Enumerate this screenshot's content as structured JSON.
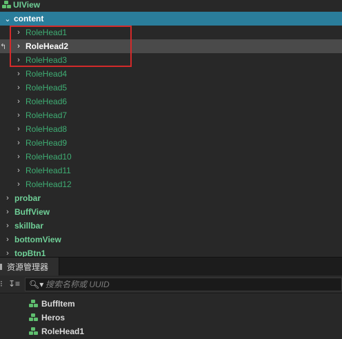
{
  "hierarchy": {
    "root": {
      "label": "UIView"
    },
    "content": {
      "label": "content"
    },
    "children": [
      {
        "label": "RoleHead1"
      },
      {
        "label": "RoleHead2"
      },
      {
        "label": "RoleHead3"
      },
      {
        "label": "RoleHead4"
      },
      {
        "label": "RoleHead5"
      },
      {
        "label": "RoleHead6"
      },
      {
        "label": "RoleHead7"
      },
      {
        "label": "RoleHead8"
      },
      {
        "label": "RoleHead9"
      },
      {
        "label": "RoleHead10"
      },
      {
        "label": "RoleHead11"
      },
      {
        "label": "RoleHead12"
      }
    ],
    "selected_child": "RoleHead2",
    "siblings": [
      {
        "label": "probar"
      },
      {
        "label": "BuffView"
      },
      {
        "label": "skillbar"
      },
      {
        "label": "bottomView"
      },
      {
        "label": "topBtn1"
      }
    ]
  },
  "assets_panel": {
    "tab_label": "资源管理器",
    "search": {
      "placeholder": "搜索名称或 UUID",
      "value": ""
    },
    "items": [
      {
        "label": "BuffItem"
      },
      {
        "label": "Heros"
      },
      {
        "label": "RoleHead1"
      }
    ]
  },
  "colors": {
    "content_row_bg": "#2a7d9b",
    "selected_row_bg": "#4a4a4a",
    "node_text": "#3fae74",
    "highlight_box": "#d42a2a"
  }
}
